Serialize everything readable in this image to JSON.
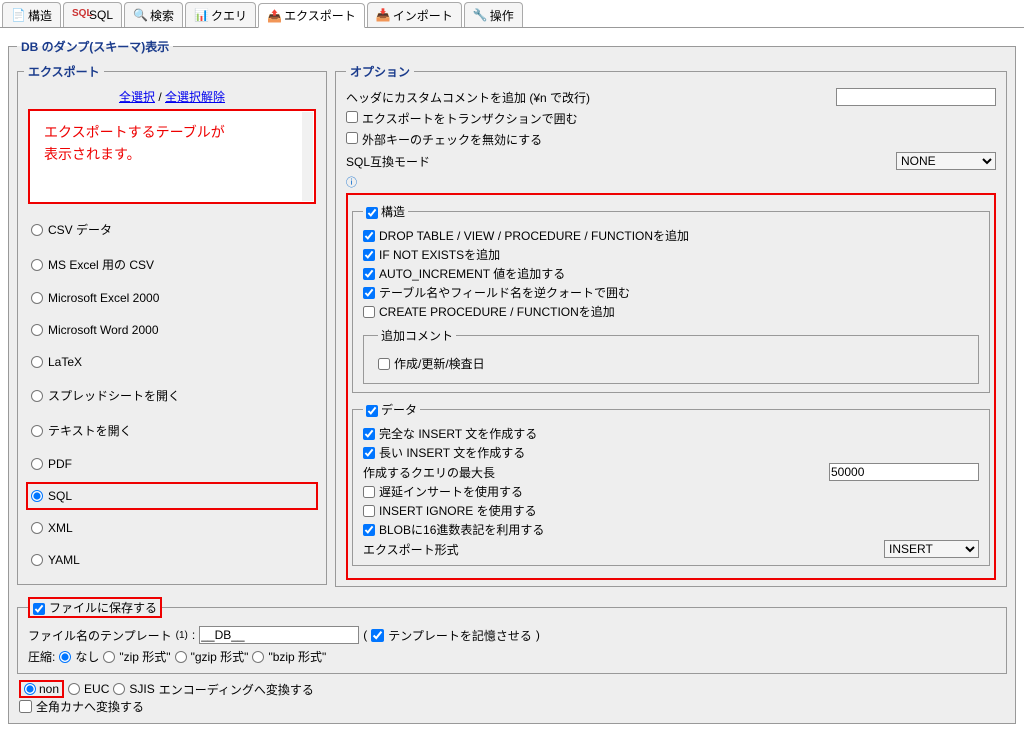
{
  "tabs": {
    "structure": "構造",
    "sql": "SQL",
    "search": "検索",
    "query": "クエリ",
    "export": "エクスポート",
    "import": "インポート",
    "operations": "操作"
  },
  "main_legend": "DB のダンプ(スキーマ)表示",
  "export": {
    "legend": "エクスポート",
    "select_all": "全選択",
    "unselect_all": "全選択解除",
    "table_placeholder_line1": "エクスポートするテーブルが",
    "table_placeholder_line2": "表示されます。",
    "formats": {
      "csv": "CSV データ",
      "csv_excel": "MS Excel 用の CSV",
      "excel2000": "Microsoft Excel 2000",
      "word2000": "Microsoft Word 2000",
      "latex": "LaTeX",
      "ods": "スプレッドシートを開く",
      "odt": "テキストを開く",
      "pdf": "PDF",
      "sql": "SQL",
      "xml": "XML",
      "yaml": "YAML"
    }
  },
  "options": {
    "legend": "オプション",
    "header_comment": "ヘッダにカスタムコメントを追加 (¥n で改行)",
    "transaction": "エクスポートをトランザクションで囲む",
    "fk_disable": "外部キーのチェックを無効にする",
    "compat_label": "SQL互換モード",
    "compat_value": "NONE",
    "structure": {
      "legend": "構造",
      "drop": "DROP TABLE / VIEW / PROCEDURE / FUNCTIONを追加",
      "ifnotexists": "IF NOT EXISTSを追加",
      "autoinc": "AUTO_INCREMENT 値を追加する",
      "backquote": "テーブル名やフィールド名を逆クォートで囲む",
      "procfunc": "CREATE PROCEDURE / FUNCTIONを追加",
      "add_comment_legend": "追加コメント",
      "dates": "作成/更新/検査日"
    },
    "data": {
      "legend": "データ",
      "complete": "完全な INSERT 文を作成する",
      "extended": "長い INSERT 文を作成する",
      "max_query": "作成するクエリの最大長",
      "max_query_val": "50000",
      "delayed": "遅延インサートを使用する",
      "ignore": "INSERT IGNORE を使用する",
      "blob_hex": "BLOBに16進数表記を利用する",
      "export_type": "エクスポート形式",
      "export_type_val": "INSERT"
    }
  },
  "save": {
    "legend": "ファイルに保存する",
    "tpl_label": "ファイル名のテンプレート",
    "sup": "(1)",
    "tpl_value": "__DB__",
    "remember": "テンプレートを記憶させる",
    "compress": "圧縮:",
    "none": "なし",
    "zip": "\"zip 形式\"",
    "gzip": "\"gzip 形式\"",
    "bzip": "\"bzip 形式\""
  },
  "encoding": {
    "non": "non",
    "euc": "EUC",
    "sjis": "SJIS",
    "convert": "エンコーディングへ変換する",
    "kana": "全角カナへ変換する"
  }
}
